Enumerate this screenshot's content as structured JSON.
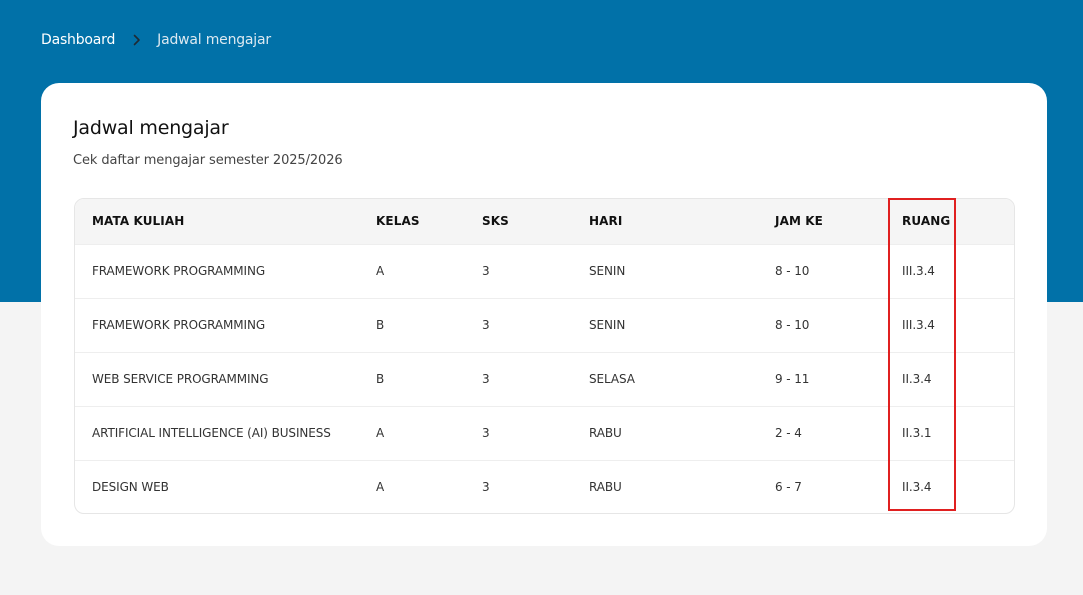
{
  "breadcrumb": {
    "home": "Dashboard",
    "current": "Jadwal mengajar"
  },
  "card": {
    "title": "Jadwal mengajar",
    "subtitle": "Cek daftar mengajar semester 2025/2026"
  },
  "table": {
    "headers": {
      "course": "MATA KULIAH",
      "class": "KELAS",
      "credits": "SKS",
      "day": "HARI",
      "period": "JAM KE",
      "room": "RUANG"
    },
    "rows": [
      {
        "course": "FRAMEWORK PROGRAMMING",
        "class": "A",
        "credits": "3",
        "day": "SENIN",
        "period": "8 - 10",
        "room": "III.3.4"
      },
      {
        "course": "FRAMEWORK PROGRAMMING",
        "class": "B",
        "credits": "3",
        "day": "SENIN",
        "period": "8 - 10",
        "room": "III.3.4"
      },
      {
        "course": "WEB SERVICE PROGRAMMING",
        "class": "B",
        "credits": "3",
        "day": "SELASA",
        "period": "9 - 11",
        "room": "II.3.4"
      },
      {
        "course": "ARTIFICIAL INTELLIGENCE (AI) BUSINESS",
        "class": "A",
        "credits": "3",
        "day": "RABU",
        "period": "2 - 4",
        "room": "II.3.1"
      },
      {
        "course": "DESIGN WEB",
        "class": "A",
        "credits": "3",
        "day": "RABU",
        "period": "6 - 7",
        "room": "II.3.4"
      }
    ]
  },
  "colors": {
    "header_band": "#0171a8",
    "page_background": "#f4f4f4",
    "highlight": "#e02020"
  },
  "icons": {
    "breadcrumb_separator": "chevron-right-icon"
  }
}
